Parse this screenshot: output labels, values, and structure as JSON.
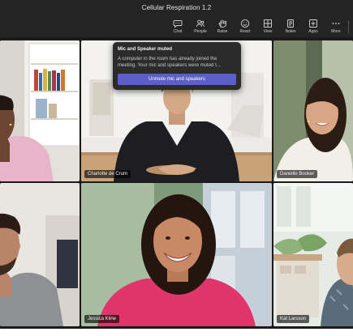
{
  "window": {
    "title": "Cellular Respiration 1.2"
  },
  "toolbar": [
    {
      "label": "Chat",
      "icon": "chat-icon"
    },
    {
      "label": "People",
      "icon": "people-icon"
    },
    {
      "label": "Raise",
      "icon": "raise-hand-icon"
    },
    {
      "label": "React",
      "icon": "react-icon"
    },
    {
      "label": "View",
      "icon": "view-icon"
    },
    {
      "label": "Notes",
      "icon": "notes-icon"
    },
    {
      "label": "Apps",
      "icon": "apps-icon"
    },
    {
      "label": "More",
      "icon": "more-icon"
    }
  ],
  "popup": {
    "title": "Mic and Speaker muted",
    "message": "A computer in the room has already joined the meeting. Your mic and speakers were muted t...",
    "button": "Unmute mic and speakers"
  },
  "participants": [
    {
      "name": ""
    },
    {
      "name": "Charlotte de Crum"
    },
    {
      "name": "Danielle Booker"
    },
    {
      "name": ""
    },
    {
      "name": "Jessica Kline"
    },
    {
      "name": "Kat Larsson"
    }
  ],
  "colors": {
    "accent": "#5b5fc7",
    "chrome": "#242424"
  }
}
